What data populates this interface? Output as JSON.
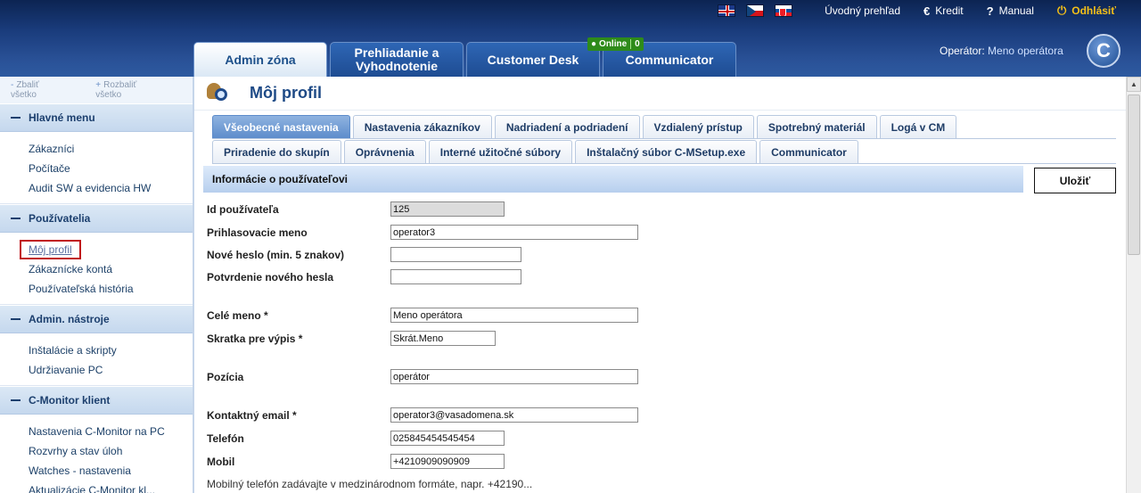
{
  "header": {
    "flags": [
      "flag-en-icon",
      "flag-cz-icon",
      "flag-sk-icon"
    ],
    "links": {
      "home": "Úvodný prehľad",
      "credit": "Kredit",
      "manual": "Manual",
      "logout": "Odhlásiť"
    },
    "tabs": [
      {
        "label": "Admin zóna"
      },
      {
        "label": "Prehliadanie a Vyhodnotenie"
      },
      {
        "label": "Customer Desk"
      },
      {
        "label": "Communicator"
      }
    ],
    "online": {
      "label": "Online",
      "count": "0"
    },
    "operator_label": "Operátor:",
    "operator_name": "Meno operátora",
    "logo_letter": "C"
  },
  "sidebar": {
    "collapse": "Zbaliť všetko",
    "expand": "Rozbaliť všetko",
    "sections": [
      {
        "title": "Hlavné menu",
        "items": [
          "Zákazníci",
          "Počítače",
          "Audit SW a evidencia HW"
        ]
      },
      {
        "title": "Používatelia",
        "items": [
          "Môj profil",
          "Zákaznícke kontá",
          "Používateľská história"
        ]
      },
      {
        "title": "Admin. nástroje",
        "items": [
          "Inštalácie a skripty",
          "Udržiavanie PC"
        ]
      },
      {
        "title": "C-Monitor klient",
        "items": [
          "Nastavenia C-Monitor na PC",
          "Rozvrhy a stav úloh",
          "Watches - nastavenia",
          "Aktualizácie C-Monitor kl..."
        ]
      }
    ]
  },
  "page": {
    "title": "Môj profil",
    "subtabs_row1": [
      "Všeobecné nastavenia",
      "Nastavenia zákazníkov",
      "Nadriadení a podriadení",
      "Vzdialený prístup",
      "Spotrebný materiál",
      "Logá v CM"
    ],
    "subtabs_row2": [
      "Priradenie do skupín",
      "Oprávnenia",
      "Interné užitočné súbory",
      "Inštalačný súbor C-MSetup.exe",
      "Communicator"
    ],
    "section_title": "Informácie o používateľovi",
    "save_label": "Uložiť",
    "fields": {
      "user_id": {
        "label": "Id používateľa",
        "value": "125"
      },
      "login": {
        "label": "Prihlasovacie meno",
        "value": "operator3"
      },
      "new_password": {
        "label": "Nové heslo (min. 5 znakov)",
        "value": ""
      },
      "confirm_password": {
        "label": "Potvrdenie nového hesla",
        "value": ""
      },
      "full_name": {
        "label": "Celé meno *",
        "value": "Meno operátora"
      },
      "short_name": {
        "label": "Skratka pre výpis *",
        "value": "Skrát.Meno"
      },
      "position": {
        "label": "Pozícia",
        "value": "operátor"
      },
      "email": {
        "label": "Kontaktný email *",
        "value": "operator3@vasadomena.sk"
      },
      "phone": {
        "label": "Telefón",
        "value": "025845454545454"
      },
      "mobile": {
        "label": "Mobil",
        "value": "+4210909090909"
      }
    },
    "mobile_hint": "Mobilný telefón zadávajte v medzinárodnom formáte, napr. +42190..."
  },
  "colors": {
    "header_top": "#0c2452",
    "header_bottom": "#2d5aa0",
    "logout": "#f5c018",
    "online": "#2e8b1a",
    "active_subtab": "#5d8ccb",
    "selected_outline": "#c0141b"
  }
}
